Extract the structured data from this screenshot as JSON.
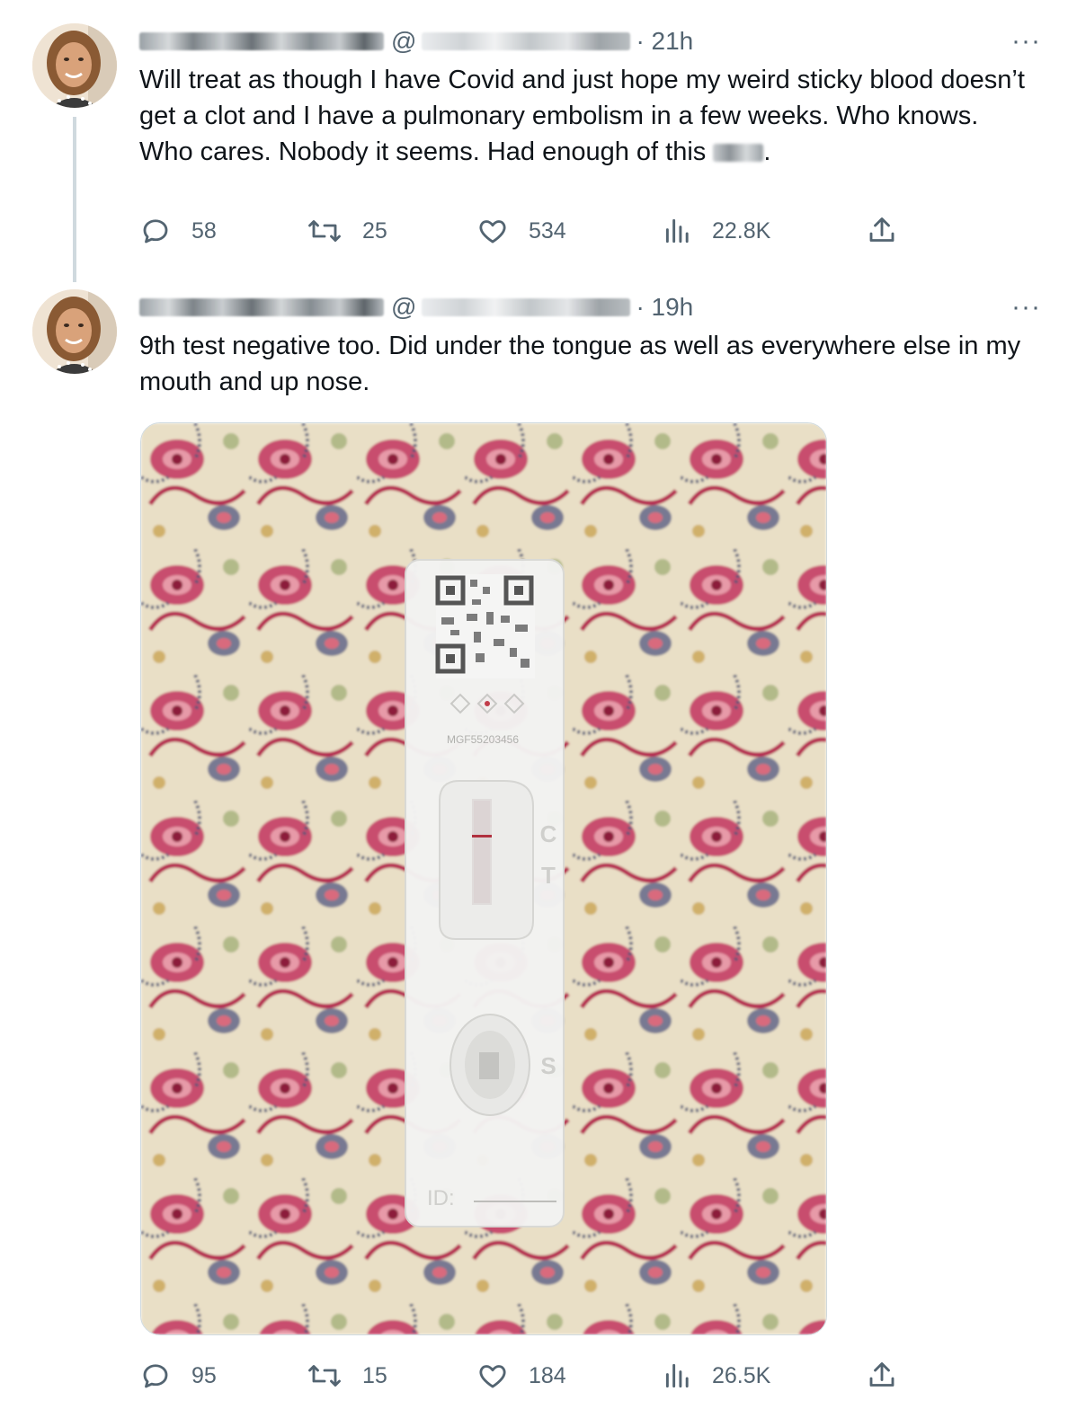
{
  "tweets": [
    {
      "handle_prefix": "@",
      "time": "· 21h",
      "more": "···",
      "text_before": "Will treat as though I have Covid and just hope my weird sticky blood doesn’t get a clot and I have a pulmonary embolism in a few weeks. Who knows. Who cares. Nobody it seems. Had enough of this ",
      "text_after": ".",
      "replies": "58",
      "retweets": "25",
      "likes": "534",
      "views": "22.8K"
    },
    {
      "handle_prefix": "@",
      "time": "· 19h",
      "more": "···",
      "text": "9th test negative too. Did under the tongue as well as everywhere else in my mouth and up nose.",
      "replies": "95",
      "retweets": "15",
      "likes": "184",
      "views": "26.5K",
      "image": {
        "test_code": "MGF55203456",
        "label_c": "C",
        "label_t": "T",
        "label_s": "S",
        "label_id": "ID:"
      }
    }
  ],
  "colors": {
    "text": "#0f1419",
    "secondary": "#536471",
    "thread_line": "#cfd9de"
  }
}
